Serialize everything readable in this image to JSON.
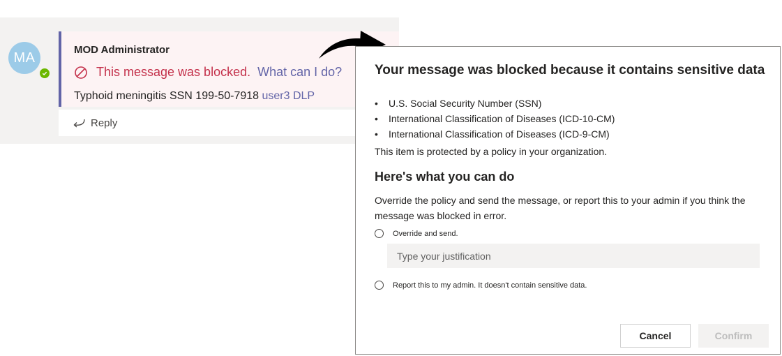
{
  "chat": {
    "avatar_initials": "MA",
    "sender": "MOD Administrator",
    "blocked_text": "This message was blocked.",
    "what_link": "What can I do?",
    "message_text": "Typhoid meningitis SSN 199-50-7918",
    "message_tag": "user3 DLP",
    "reply_label": "Reply",
    "colors": {
      "blocked": "#c4314b",
      "accent": "#6264a7",
      "presence": "#6bb700"
    }
  },
  "dialog": {
    "title": "Your message was blocked because it contains sensitive data",
    "sensitive_types": [
      "U.S. Social Security Number (SSN)",
      "International Classification of Diseases (ICD-10-CM)",
      "International Classification of Diseases (ICD-9-CM)"
    ],
    "policy_note": "This item is protected by a policy in your organization.",
    "section_title": "Here's what you can do",
    "override_description": "Override the policy and send the message, or report this to your admin if you think the message was blocked in error.",
    "option_override": "Override and send.",
    "justification_placeholder": "Type your justification",
    "option_report": "Report this to my admin. It doesn't contain sensitive data.",
    "cancel_label": "Cancel",
    "confirm_label": "Confirm"
  }
}
